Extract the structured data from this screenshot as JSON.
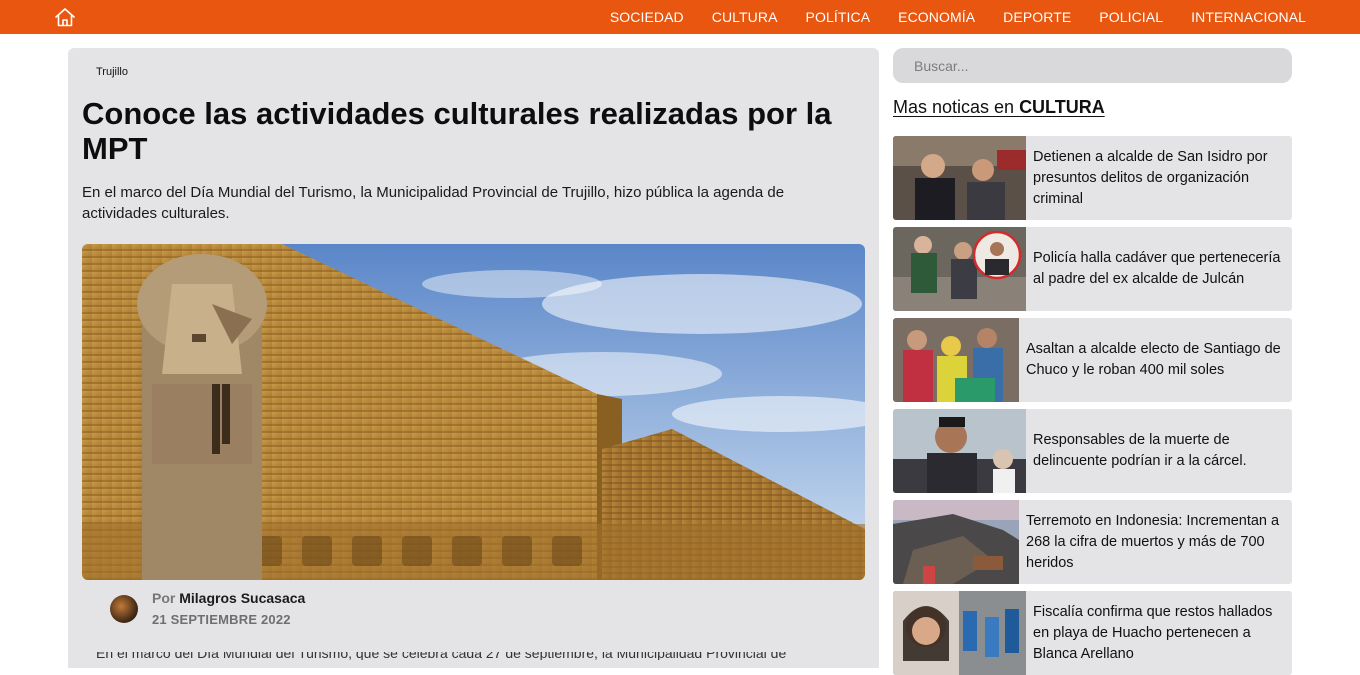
{
  "nav": {
    "items": [
      "SOCIEDAD",
      "CULTURA",
      "POLÍTICA",
      "ECONOMÍA",
      "DEPORTE",
      "POLICIAL",
      "INTERNACIONAL"
    ]
  },
  "article": {
    "breadcrumb": "Trujillo",
    "title": "Conoce las actividades culturales realizadas por la MPT",
    "lead": "En el marco del Día Mundial del Turismo, la Municipalidad Provincial de Trujillo, hizo pública la agenda de actividades culturales.",
    "author_prefix": "Por",
    "author": "Milagros Sucasaca",
    "date": "21 SEPTIEMBRE 2022",
    "body_first_line": "En el marco del Día Mundial del Turismo, que se celebra cada 27 de septiembre, la Municipalidad Provincial de Trujillo"
  },
  "sidebar": {
    "search_placeholder": "Buscar...",
    "more_prefix": "Mas noticas en ",
    "more_section": "CULTURA",
    "news": [
      {
        "title": "Detienen a alcalde de San Isidro por presuntos delitos de organización criminal"
      },
      {
        "title": "Policía halla cadáver que pertenecería al padre del ex alcalde de Julcán"
      },
      {
        "title": "Asaltan a alcalde electo de Santiago de Chuco y le roban 400 mil soles"
      },
      {
        "title": "Responsables de la muerte de delincuente podrían ir a la cárcel."
      },
      {
        "title": "Terremoto en Indonesia: Incrementan a 268 la cifra de muertos y más de 700 heridos"
      },
      {
        "title": "Fiscalía confirma que restos hallados en playa de Huacho pertenecen a Blanca Arellano"
      }
    ]
  },
  "colors": {
    "brand": "#e8560f",
    "panel": "#e4e4e7",
    "search_bg": "#d9d9dc"
  }
}
